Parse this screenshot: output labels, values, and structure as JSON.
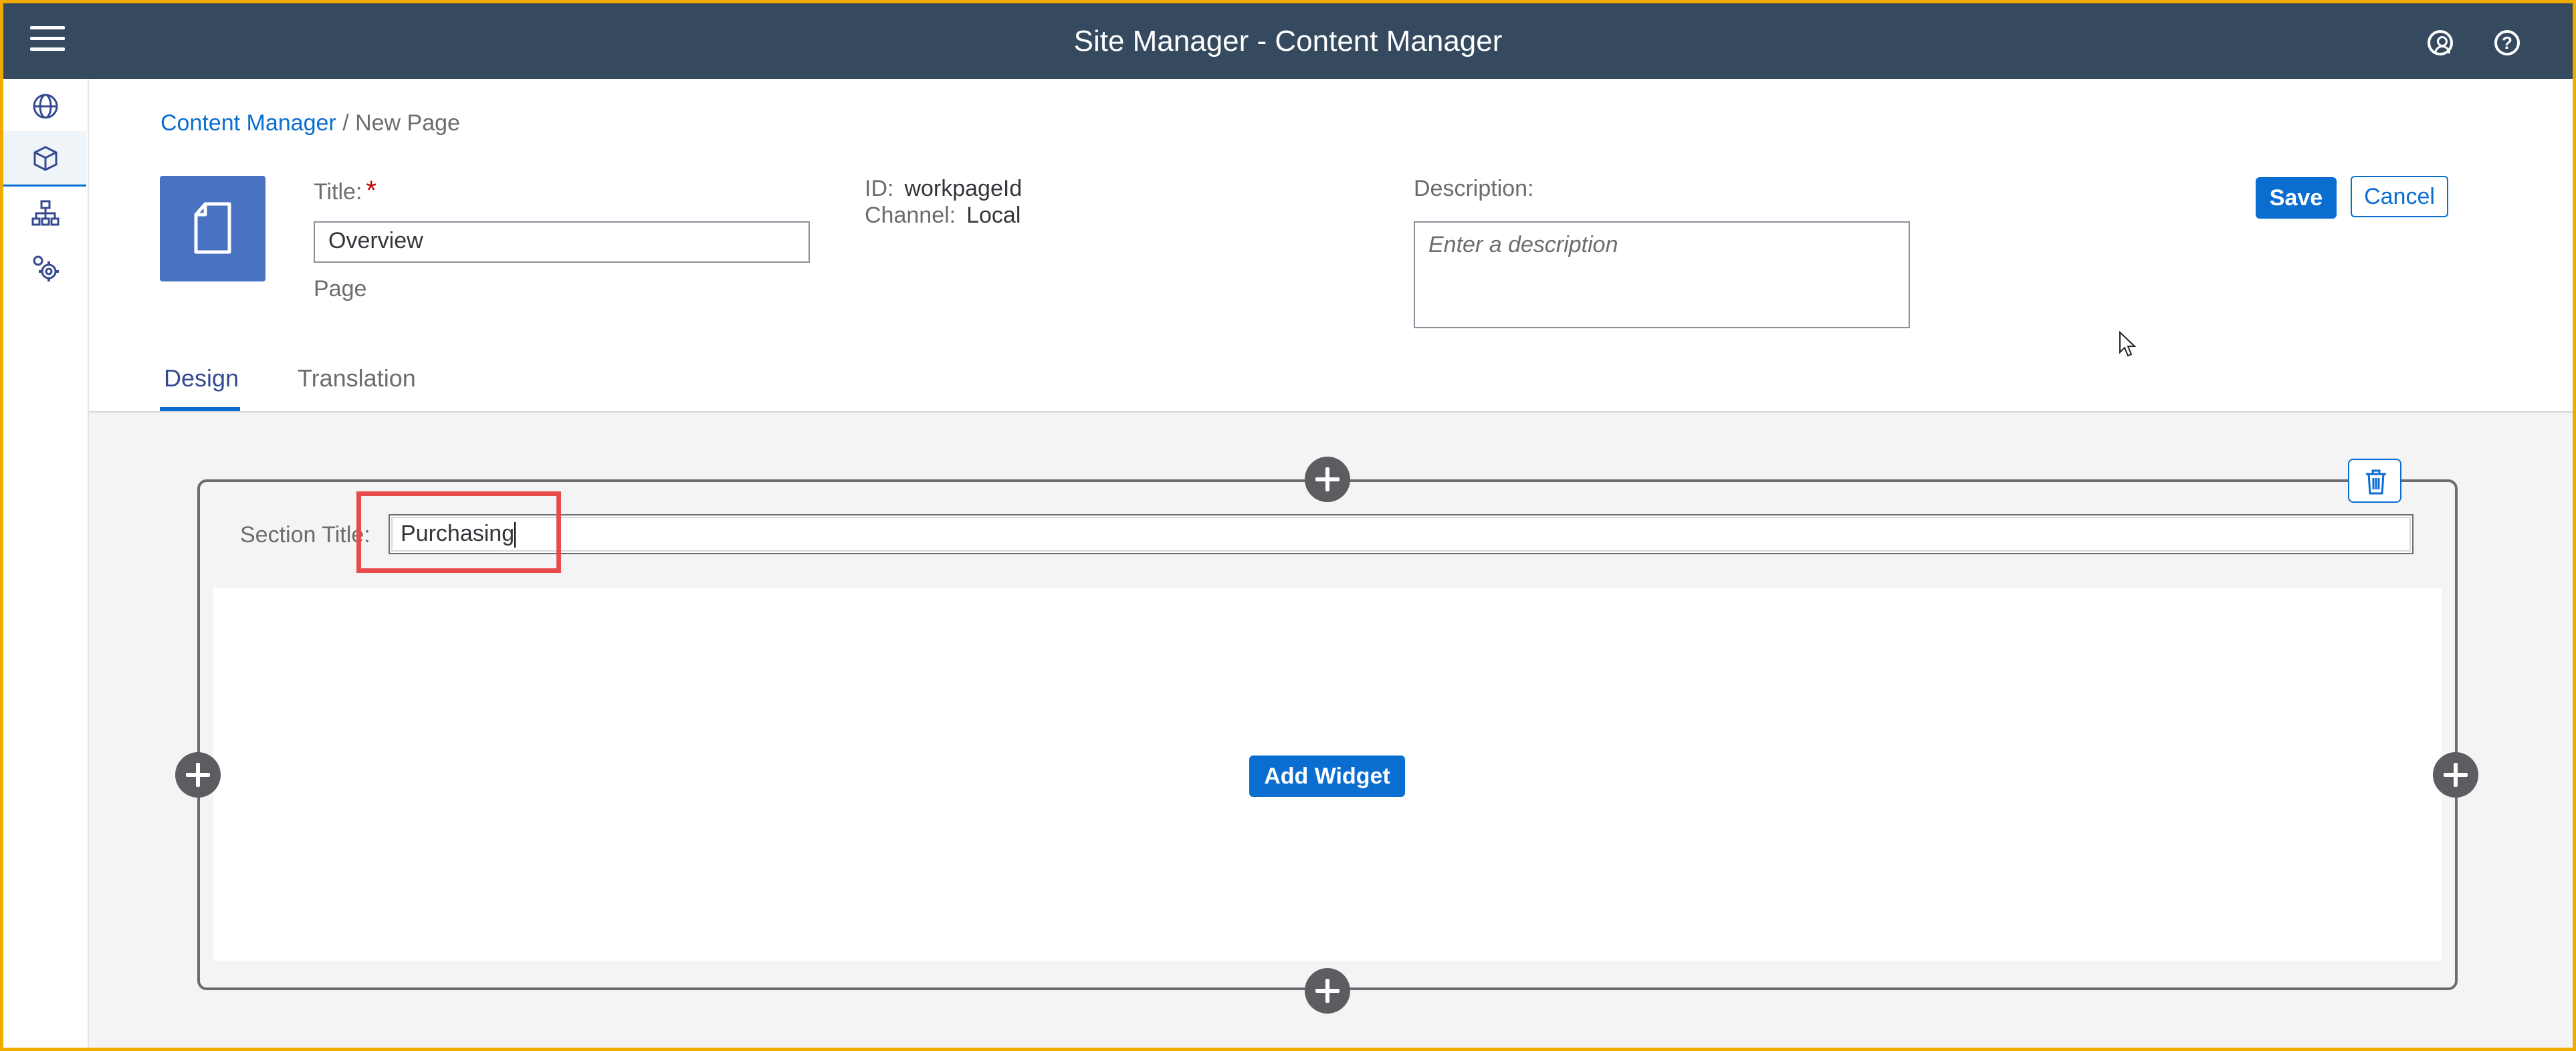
{
  "shell": {
    "title": "Site Manager - Content Manager",
    "menu_icon": "hamburger-menu-icon",
    "user_icon": "user-icon",
    "help_icon": "help-icon",
    "help_glyph": "?"
  },
  "sidebar": {
    "items": [
      {
        "icon": "globe-icon",
        "active": false
      },
      {
        "icon": "cube-icon",
        "active": true
      },
      {
        "icon": "sitemap-icon",
        "active": false
      },
      {
        "icon": "settings-gears-icon",
        "active": false
      }
    ]
  },
  "breadcrumb": {
    "link": "Content Manager",
    "separator": "/",
    "current": "New Page"
  },
  "page": {
    "icon": "document-icon",
    "title_label": "Title:",
    "required_marker": "*",
    "title_value": "Overview",
    "type_label": "Page",
    "id_label": "ID:",
    "id_value": "workpageId",
    "channel_label": "Channel:",
    "channel_value": "Local",
    "description_label": "Description:",
    "description_placeholder": "Enter a description"
  },
  "actions": {
    "save_label": "Save",
    "cancel_label": "Cancel"
  },
  "tabs": [
    {
      "label": "Design",
      "selected": true
    },
    {
      "label": "Translation",
      "selected": false
    }
  ],
  "section": {
    "title_label": "Section Title:",
    "title_value": "Purchasing",
    "add_widget_label": "Add Widget",
    "delete_icon": "trash-icon"
  },
  "colors": {
    "shell_bg": "#354a5f",
    "accent": "#0a6ed1",
    "highlight": "#e74c4c",
    "frame": "#f0ab00"
  }
}
